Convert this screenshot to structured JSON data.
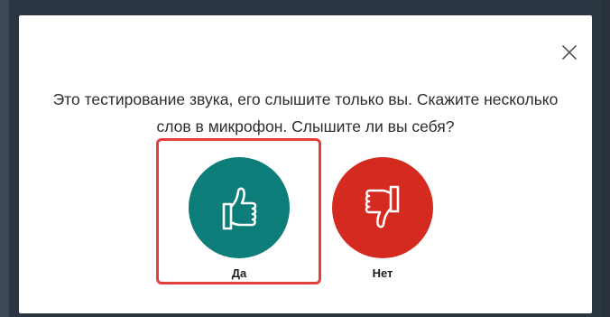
{
  "dialog": {
    "prompt": "Это тестирование звука, его слышите только вы. Скажите несколько слов в микрофон. Слышите ли вы себя?",
    "close_icon": "close-icon",
    "yes": {
      "label": "Да",
      "icon": "thumbs-up-icon",
      "color": "#0c7d79"
    },
    "no": {
      "label": "Нет",
      "icon": "thumbs-down-icon",
      "color": "#d52a1f"
    },
    "highlight_color": "#e2413b"
  }
}
